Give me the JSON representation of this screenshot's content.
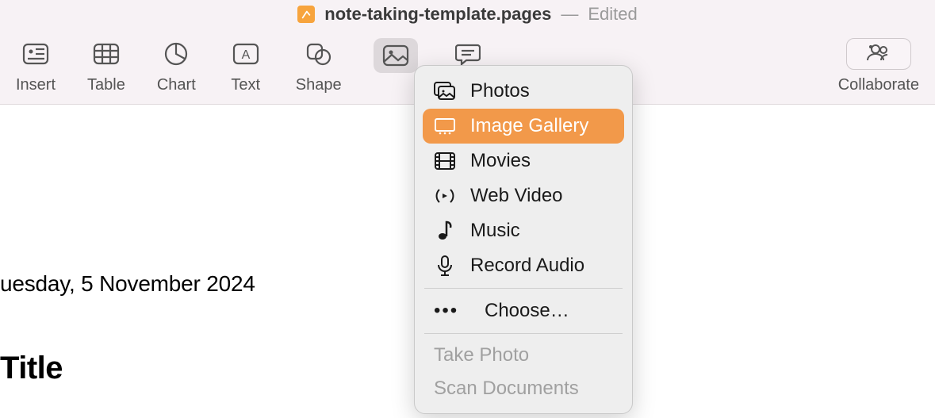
{
  "titlebar": {
    "filename": "note-taking-template.pages",
    "dash": "—",
    "edited": "Edited"
  },
  "toolbar": {
    "insert": "Insert",
    "table": "Table",
    "chart": "Chart",
    "text": "Text",
    "shape": "Shape",
    "collaborate": "Collaborate"
  },
  "dropdown": {
    "photos": "Photos",
    "image_gallery": "Image Gallery",
    "movies": "Movies",
    "web_video": "Web Video",
    "music": "Music",
    "record_audio": "Record Audio",
    "choose": "Choose…",
    "take_photo": "Take Photo",
    "scan_documents": "Scan Documents"
  },
  "document": {
    "date": "uesday, 5 November 2024",
    "title": "Title"
  }
}
